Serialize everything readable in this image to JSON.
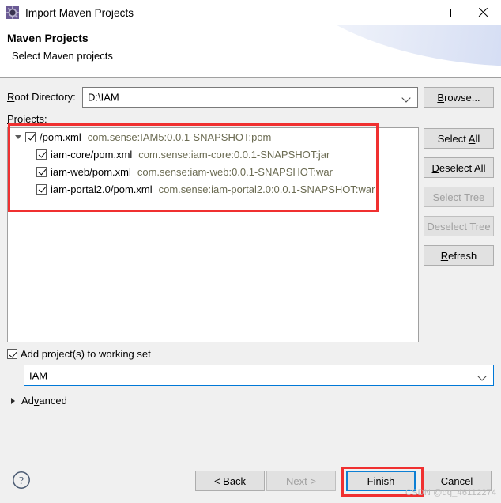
{
  "window": {
    "title": "Import Maven Projects",
    "icon": "maven-gear-icon",
    "minimize_label": "Minimize",
    "maximize_label": "Maximize",
    "close_label": "Close"
  },
  "header": {
    "title": "Maven Projects",
    "subtitle": "Select Maven projects"
  },
  "root_directory": {
    "label": "Root Directory:",
    "value": "D:\\IAM",
    "placeholder": "",
    "browse_label": "Browse..."
  },
  "projects": {
    "label": "Projects:",
    "tree": [
      {
        "name": "/pom.xml",
        "coordinates": "com.sense:IAM5:0.0.1-SNAPSHOT:pom",
        "checked": true,
        "level": 0,
        "expanded": true
      },
      {
        "name": "iam-core/pom.xml",
        "coordinates": "com.sense:iam-core:0.0.1-SNAPSHOT:jar",
        "checked": true,
        "level": 1,
        "expanded": false
      },
      {
        "name": "iam-web/pom.xml",
        "coordinates": "com.sense:iam-web:0.0.1-SNAPSHOT:war",
        "checked": true,
        "level": 1,
        "expanded": false
      },
      {
        "name": "iam-portal2.0/pom.xml",
        "coordinates": "com.sense:iam-portal2.0:0.0.1-SNAPSHOT:war",
        "checked": true,
        "level": 1,
        "expanded": false
      }
    ]
  },
  "side_buttons": [
    {
      "label": "Select All",
      "enabled": true
    },
    {
      "label": "Deselect All",
      "enabled": true
    },
    {
      "label": "Select Tree",
      "enabled": false
    },
    {
      "label": "Deselect Tree",
      "enabled": false
    },
    {
      "label": "Refresh",
      "enabled": true
    }
  ],
  "working_set": {
    "checkbox_label": "Add project(s) to working set",
    "checked": true,
    "value": "IAM"
  },
  "advanced": {
    "label": "Advanced",
    "expanded": false
  },
  "footer": {
    "help_label": "?",
    "back_label": "< Back",
    "next_label": "Next >",
    "finish_label": "Finish",
    "cancel_label": "Cancel",
    "back_enabled": true,
    "next_enabled": false,
    "finish_enabled": true,
    "cancel_enabled": true
  },
  "watermark": "CSDN @qq_46112274",
  "colors": {
    "dialog_background": "#f0f0f0",
    "field_background": "#ffffff",
    "button_face": "#e1e1e1",
    "focus_border": "#0078d7",
    "annotation_red": "#f03030",
    "coordinate_text": "#6b6b52",
    "disabled_text": "#a0a0a0"
  }
}
